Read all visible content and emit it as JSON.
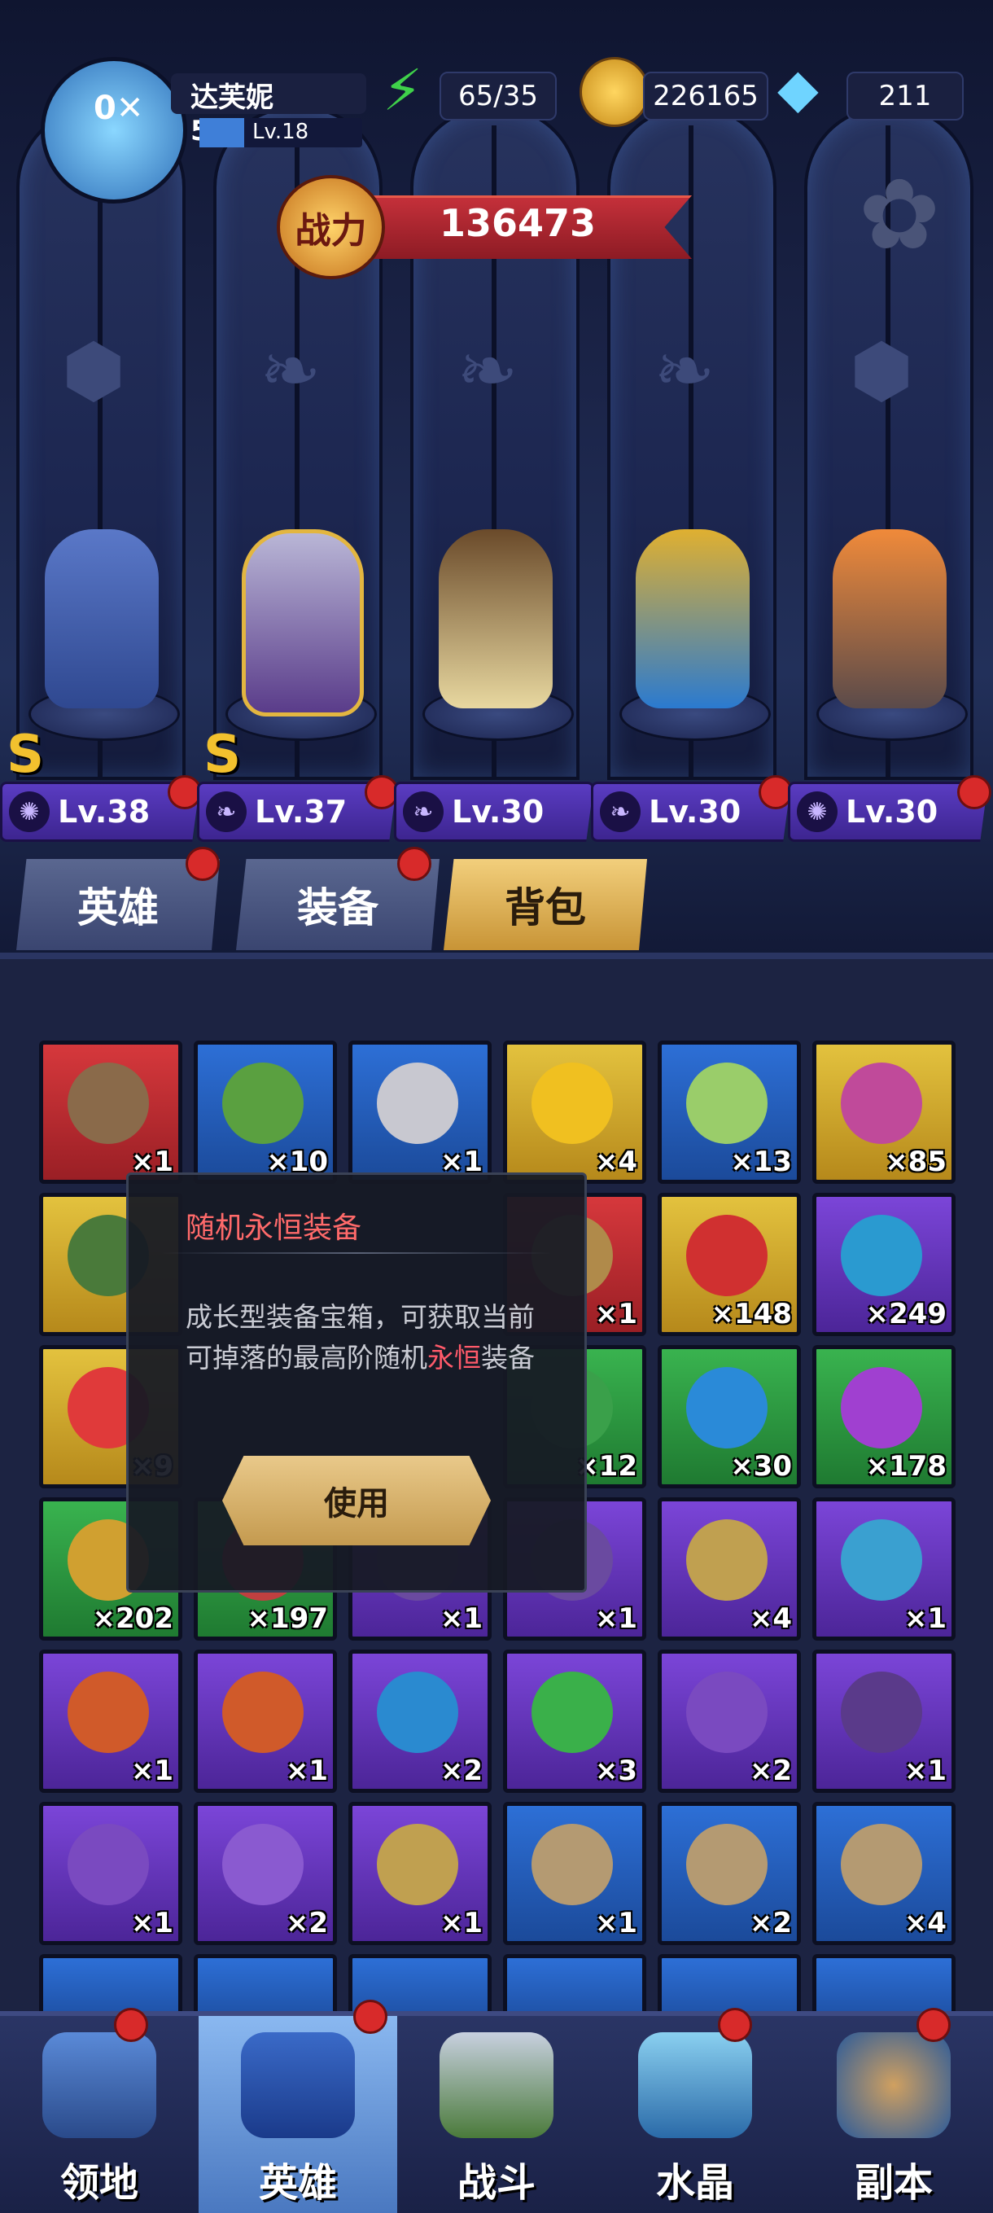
{
  "player": {
    "name": "达芙妮52964",
    "level": "Lv.18"
  },
  "resources": {
    "stamina": "65/35",
    "gold": "226165",
    "gems": "211"
  },
  "power": {
    "label": "战力",
    "value": "136473"
  },
  "heroes": [
    {
      "level": "Lv.38",
      "rank": "S",
      "class_icon": "claw-icon"
    },
    {
      "level": "Lv.37",
      "rank": "S",
      "class_icon": "wing-icon"
    },
    {
      "level": "Lv.30",
      "rank": "",
      "class_icon": "wing-icon"
    },
    {
      "level": "Lv.30",
      "rank": "",
      "class_icon": "wing-icon"
    },
    {
      "level": "Lv.30",
      "rank": "",
      "class_icon": "claw-icon"
    }
  ],
  "tabs": [
    "英雄",
    "装备",
    "背包"
  ],
  "active_tab": "背包",
  "inventory": [
    [
      "×1",
      "×10",
      "×1",
      "×4",
      "×13",
      "×85"
    ],
    [
      "",
      "",
      "",
      "×1",
      "×148",
      "×249"
    ],
    [
      "×9",
      "",
      "",
      "×12",
      "×30",
      "×178"
    ],
    [
      "×202",
      "×197",
      "×1",
      "×1",
      "×4",
      "×1"
    ],
    [
      "×1",
      "×1",
      "×2",
      "×3",
      "×2",
      "×1"
    ],
    [
      "×1",
      "×2",
      "×1",
      "×1",
      "×2",
      "×4"
    ]
  ],
  "tooltip": {
    "title": "随机永恒装备",
    "desc_before": "成长型装备宝箱，可获取当前可掉落的最高阶随机",
    "desc_highlight": "永恒",
    "desc_after": "装备",
    "button": "使用"
  },
  "nav": [
    "领地",
    "英雄",
    "战斗",
    "水晶",
    "副本"
  ],
  "colors": {
    "accent_red": "#d82a2a",
    "tab_active": "#e2b65c",
    "level_bar": "#5a3cc2"
  }
}
